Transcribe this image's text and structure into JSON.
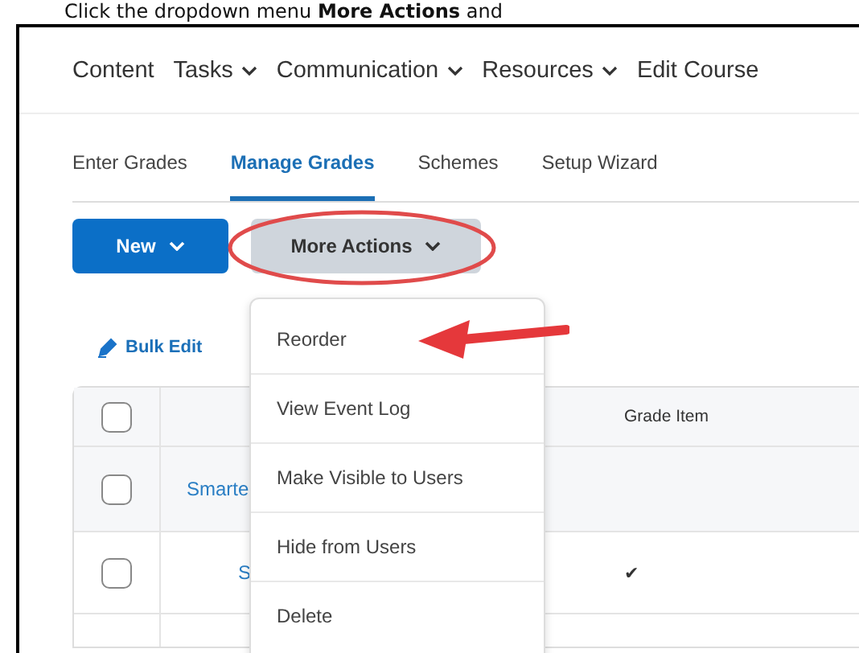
{
  "caption": "Click the dropdown menu **More Actions** and",
  "nav": [
    {
      "label": "Content",
      "dropdown": false
    },
    {
      "label": "Tasks",
      "dropdown": true
    },
    {
      "label": "Communication",
      "dropdown": true
    },
    {
      "label": "Resources",
      "dropdown": true
    },
    {
      "label": "Edit Course",
      "dropdown": false
    }
  ],
  "tabs": [
    {
      "label": "Enter Grades",
      "selected": false
    },
    {
      "label": "Manage Grades",
      "selected": true
    },
    {
      "label": "Schemes",
      "selected": false
    },
    {
      "label": "Setup Wizard",
      "selected": false
    }
  ],
  "buttons": [
    {
      "label": "New",
      "kind": "primary"
    },
    {
      "label": "More Actions",
      "kind": "secondary"
    }
  ],
  "bulk_edit": "Bulk Edit",
  "table": {
    "header": {
      "checked": false,
      "column_3": "Grade Item"
    },
    "rows": [
      {
        "checked": false,
        "name": "Smarte",
        "indent": false
      },
      {
        "checked": false,
        "name": "S",
        "indent": true,
        "mark": "✔"
      }
    ]
  },
  "menu": [
    {
      "label": "Reorder"
    },
    {
      "label": "View Event Log"
    },
    {
      "label": "Make Visible to Users"
    },
    {
      "label": "Hide from Users"
    },
    {
      "label": "Delete"
    }
  ]
}
